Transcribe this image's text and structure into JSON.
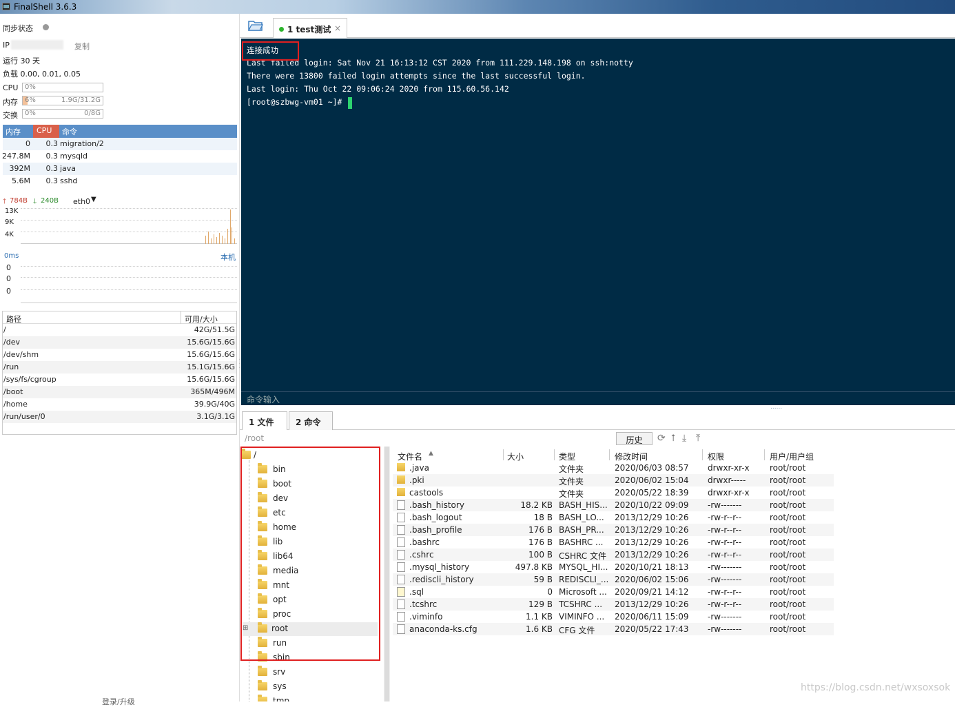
{
  "window": {
    "title": "FinalShell 3.6.3"
  },
  "sidebar": {
    "sync_label": "同步状态",
    "ip_label": "IP",
    "copy_label": "复制",
    "uptime": "运行 30 天",
    "load": "负载 0.00, 0.01, 0.05",
    "cpu": {
      "label": "CPU",
      "percent": "0%",
      "fill": 0.0
    },
    "mem": {
      "label": "内存",
      "percent": "6%",
      "value": "1.9G/31.2G",
      "fill": 0.06
    },
    "swap": {
      "label": "交换",
      "percent": "0%",
      "value": "0/8G",
      "fill": 0.0
    },
    "proc_headers": [
      "内存",
      "CPU",
      "命令"
    ],
    "procs": [
      {
        "mem": "0",
        "cpu": "0.3",
        "cmd": "migration/2"
      },
      {
        "mem": "247.8M",
        "cpu": "0.3",
        "cmd": "mysqld"
      },
      {
        "mem": "392M",
        "cpu": "0.3",
        "cmd": "java"
      },
      {
        "mem": "5.6M",
        "cpu": "0.3",
        "cmd": "sshd"
      }
    ],
    "net": {
      "up": "784B",
      "down": "240B",
      "iface": "eth0",
      "ticks": [
        "13K",
        "9K",
        "4K"
      ]
    },
    "ping": {
      "value": "0ms",
      "target": "本机",
      "ticks": [
        "0",
        "0",
        "0"
      ]
    },
    "disk_headers": [
      "路径",
      "可用/大小"
    ],
    "disks": [
      {
        "path": "/",
        "size": "42G/51.5G"
      },
      {
        "path": "/dev",
        "size": "15.6G/15.6G"
      },
      {
        "path": "/dev/shm",
        "size": "15.6G/15.6G"
      },
      {
        "path": "/run",
        "size": "15.1G/15.6G"
      },
      {
        "path": "/sys/fs/cgroup",
        "size": "15.6G/15.6G"
      },
      {
        "path": "/boot",
        "size": "365M/496M"
      },
      {
        "path": "/home",
        "size": "39.9G/40G"
      },
      {
        "path": "/run/user/0",
        "size": "3.1G/3.1G"
      }
    ],
    "footer": "登录/升级"
  },
  "session_tab": {
    "label": "1 test测试",
    "close": "×"
  },
  "terminal": {
    "lines": [
      "连接成功",
      "Last failed login: Sat Nov 21 16:13:12 CST 2020 from 111.229.148.198 on ssh:notty",
      "There were 13800 failed login attempts since the last successful login.",
      "Last login: Thu Oct 22 09:06:24 2020 from 115.60.56.142",
      "[root@szbwg-vm01 ~]# "
    ],
    "cmd_input_label": "命令输入"
  },
  "bottom_tabs": [
    "1 文件",
    "2 命令"
  ],
  "filebar": {
    "path": "/root",
    "history_label": "历史",
    "icons": [
      "refresh-icon",
      "up-icon",
      "download-icon",
      "upload-icon"
    ]
  },
  "tree": {
    "root": "/",
    "items": [
      "bin",
      "boot",
      "dev",
      "etc",
      "home",
      "lib",
      "lib64",
      "media",
      "mnt",
      "opt",
      "proc",
      "root",
      "run",
      "sbin",
      "srv",
      "sys",
      "tmp"
    ]
  },
  "files": {
    "headers": [
      "文件名",
      "大小",
      "类型",
      "修改时间",
      "权限",
      "用户/用户组"
    ],
    "rows": [
      {
        "name": ".java",
        "size": "",
        "type": "文件夹",
        "mtime": "2020/06/03 08:57",
        "perm": "drwxr-xr-x",
        "owner": "root/root",
        "kind": "dir"
      },
      {
        "name": ".pki",
        "size": "",
        "type": "文件夹",
        "mtime": "2020/06/02 15:04",
        "perm": "drwxr-----",
        "owner": "root/root",
        "kind": "dir"
      },
      {
        "name": "castools",
        "size": "",
        "type": "文件夹",
        "mtime": "2020/05/22 18:39",
        "perm": "drwxr-xr-x",
        "owner": "root/root",
        "kind": "dir"
      },
      {
        "name": ".bash_history",
        "size": "18.2 KB",
        "type": "BASH_HIS...",
        "mtime": "2020/10/22 09:09",
        "perm": "-rw-------",
        "owner": "root/root",
        "kind": "file"
      },
      {
        "name": ".bash_logout",
        "size": "18 B",
        "type": "BASH_LO...",
        "mtime": "2013/12/29 10:26",
        "perm": "-rw-r--r--",
        "owner": "root/root",
        "kind": "file"
      },
      {
        "name": ".bash_profile",
        "size": "176 B",
        "type": "BASH_PR...",
        "mtime": "2013/12/29 10:26",
        "perm": "-rw-r--r--",
        "owner": "root/root",
        "kind": "file"
      },
      {
        "name": ".bashrc",
        "size": "176 B",
        "type": "BASHRC ...",
        "mtime": "2013/12/29 10:26",
        "perm": "-rw-r--r--",
        "owner": "root/root",
        "kind": "file"
      },
      {
        "name": ".cshrc",
        "size": "100 B",
        "type": "CSHRC 文件",
        "mtime": "2013/12/29 10:26",
        "perm": "-rw-r--r--",
        "owner": "root/root",
        "kind": "file"
      },
      {
        "name": ".mysql_history",
        "size": "497.8 KB",
        "type": "MYSQL_HI...",
        "mtime": "2020/10/21 18:13",
        "perm": "-rw-------",
        "owner": "root/root",
        "kind": "file"
      },
      {
        "name": ".rediscli_history",
        "size": "59 B",
        "type": "REDISCLI_...",
        "mtime": "2020/06/02 15:06",
        "perm": "-rw-------",
        "owner": "root/root",
        "kind": "file"
      },
      {
        "name": ".sql",
        "size": "0",
        "type": "Microsoft ...",
        "mtime": "2020/09/21 14:12",
        "perm": "-rw-r--r--",
        "owner": "root/root",
        "kind": "sqlf"
      },
      {
        "name": ".tcshrc",
        "size": "129 B",
        "type": "TCSHRC ...",
        "mtime": "2013/12/29 10:26",
        "perm": "-rw-r--r--",
        "owner": "root/root",
        "kind": "file"
      },
      {
        "name": ".viminfo",
        "size": "1.1 KB",
        "type": "VIMINFO ...",
        "mtime": "2020/06/11 15:09",
        "perm": "-rw-------",
        "owner": "root/root",
        "kind": "file"
      },
      {
        "name": "anaconda-ks.cfg",
        "size": "1.6 KB",
        "type": "CFG 文件",
        "mtime": "2020/05/22 17:43",
        "perm": "-rw-------",
        "owner": "root/root",
        "kind": "file"
      }
    ]
  },
  "watermark": "https://blog.csdn.net/wxsoxsok",
  "colors": {
    "terminal_bg": "#002b45",
    "highlight": "#e02020",
    "proc_header": "#5a8fc8",
    "cpu_header": "#d9604a",
    "cursor": "#2dd36f"
  }
}
